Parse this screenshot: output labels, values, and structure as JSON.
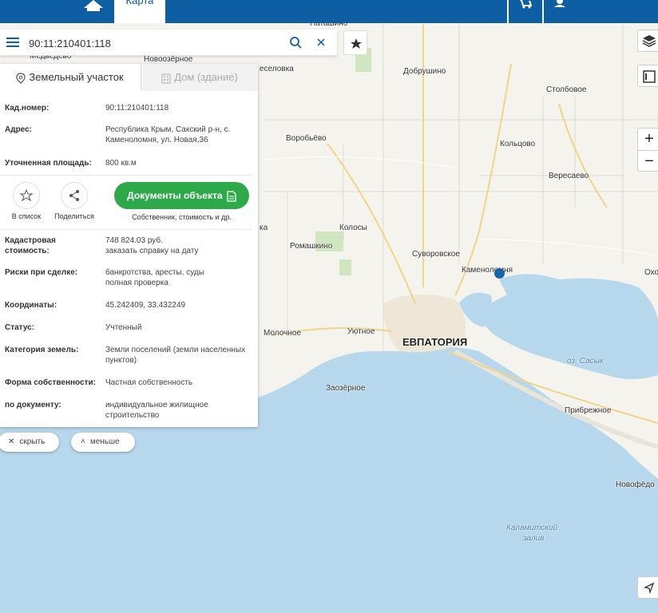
{
  "header": {
    "map_tab": "Карта",
    "home_icon": "home-icon",
    "cart_icon": "cart-icon",
    "user_icon": "user-icon",
    "brand_color": "#0d5ea3"
  },
  "search": {
    "value": "90:11:210401:118",
    "menu_icon": "menu-icon",
    "search_icon": "search-icon",
    "clear_icon": "close-icon",
    "fav_icon": "star-icon"
  },
  "panel": {
    "tabs": [
      {
        "label": "Земельный участок",
        "active": true
      },
      {
        "label": "Дом (здание)",
        "active": false
      }
    ],
    "cad_number": {
      "key": "Кад.номер:",
      "value": "90:11:210401:118"
    },
    "address": {
      "key": "Адрес:",
      "value": "Республика Крым, Сакский р-н, с. Каменоломня, ул. Новая,36"
    },
    "area": {
      "key": "Уточненная площадь:",
      "value": "800 кв.м"
    },
    "actions": {
      "add_list": "В список",
      "share": "Поделиться",
      "documents": "Документы объекта",
      "documents_sub": "Собственник, стоимость и др."
    },
    "cad_value": {
      "key": "Кадастровая стоимость:",
      "value": "748 824.03 руб.",
      "link": "заказать справку на дату"
    },
    "risks": {
      "key": "Риски при сделке:",
      "value": "банкротства, аресты, суды",
      "link": "полная проверка"
    },
    "coords": {
      "key": "Координаты:",
      "value": "45.242409, 33.432249"
    },
    "status": {
      "key": "Статус:",
      "value": "Учтенный"
    },
    "category": {
      "key": "Категория земель:",
      "value": "Земли поселений (земли населенных пунктов)"
    },
    "ownership": {
      "key": "Форма собственности:",
      "value": "Частная собственность"
    },
    "by_doc": {
      "key": "по документу:",
      "value": "индивидуальное жилищное строительство"
    },
    "accent_color": "#2ea94a",
    "link_color": "#1d6fb8"
  },
  "pills": {
    "hide": "скрыть",
    "less": "меньше"
  },
  "map": {
    "places": {
      "natashino": "Наташино",
      "medvedevo": "Медведево",
      "novoozernoe": "Новоозёрное",
      "veselovka": "еселовка",
      "dobrushino": "Добрушино",
      "stolbovoe": "Столбовое",
      "vorobyevo": "Воробьёво",
      "koltsovo": "Кольцово",
      "veresaevo": "Вересаево",
      "kolosy": "Колосы",
      "ka": "ка",
      "romashkino": "Ромашкино",
      "suvorovskoe": "Суворовское",
      "kamenolomnya": "Каменоломня",
      "okho": "Охо",
      "molochnoe": "Молочное",
      "utyonoe": "Уютное",
      "evpatoria": "ЕВПАТОРИЯ",
      "oz_sasyk": "оз. Сасык",
      "zaozernoe": "Заозёрное",
      "pribrezhnoe": "Прибрежное",
      "novofedorovka": "Новофёдо",
      "kalamit1": "Каламитский",
      "kalamit2": "залив"
    }
  }
}
